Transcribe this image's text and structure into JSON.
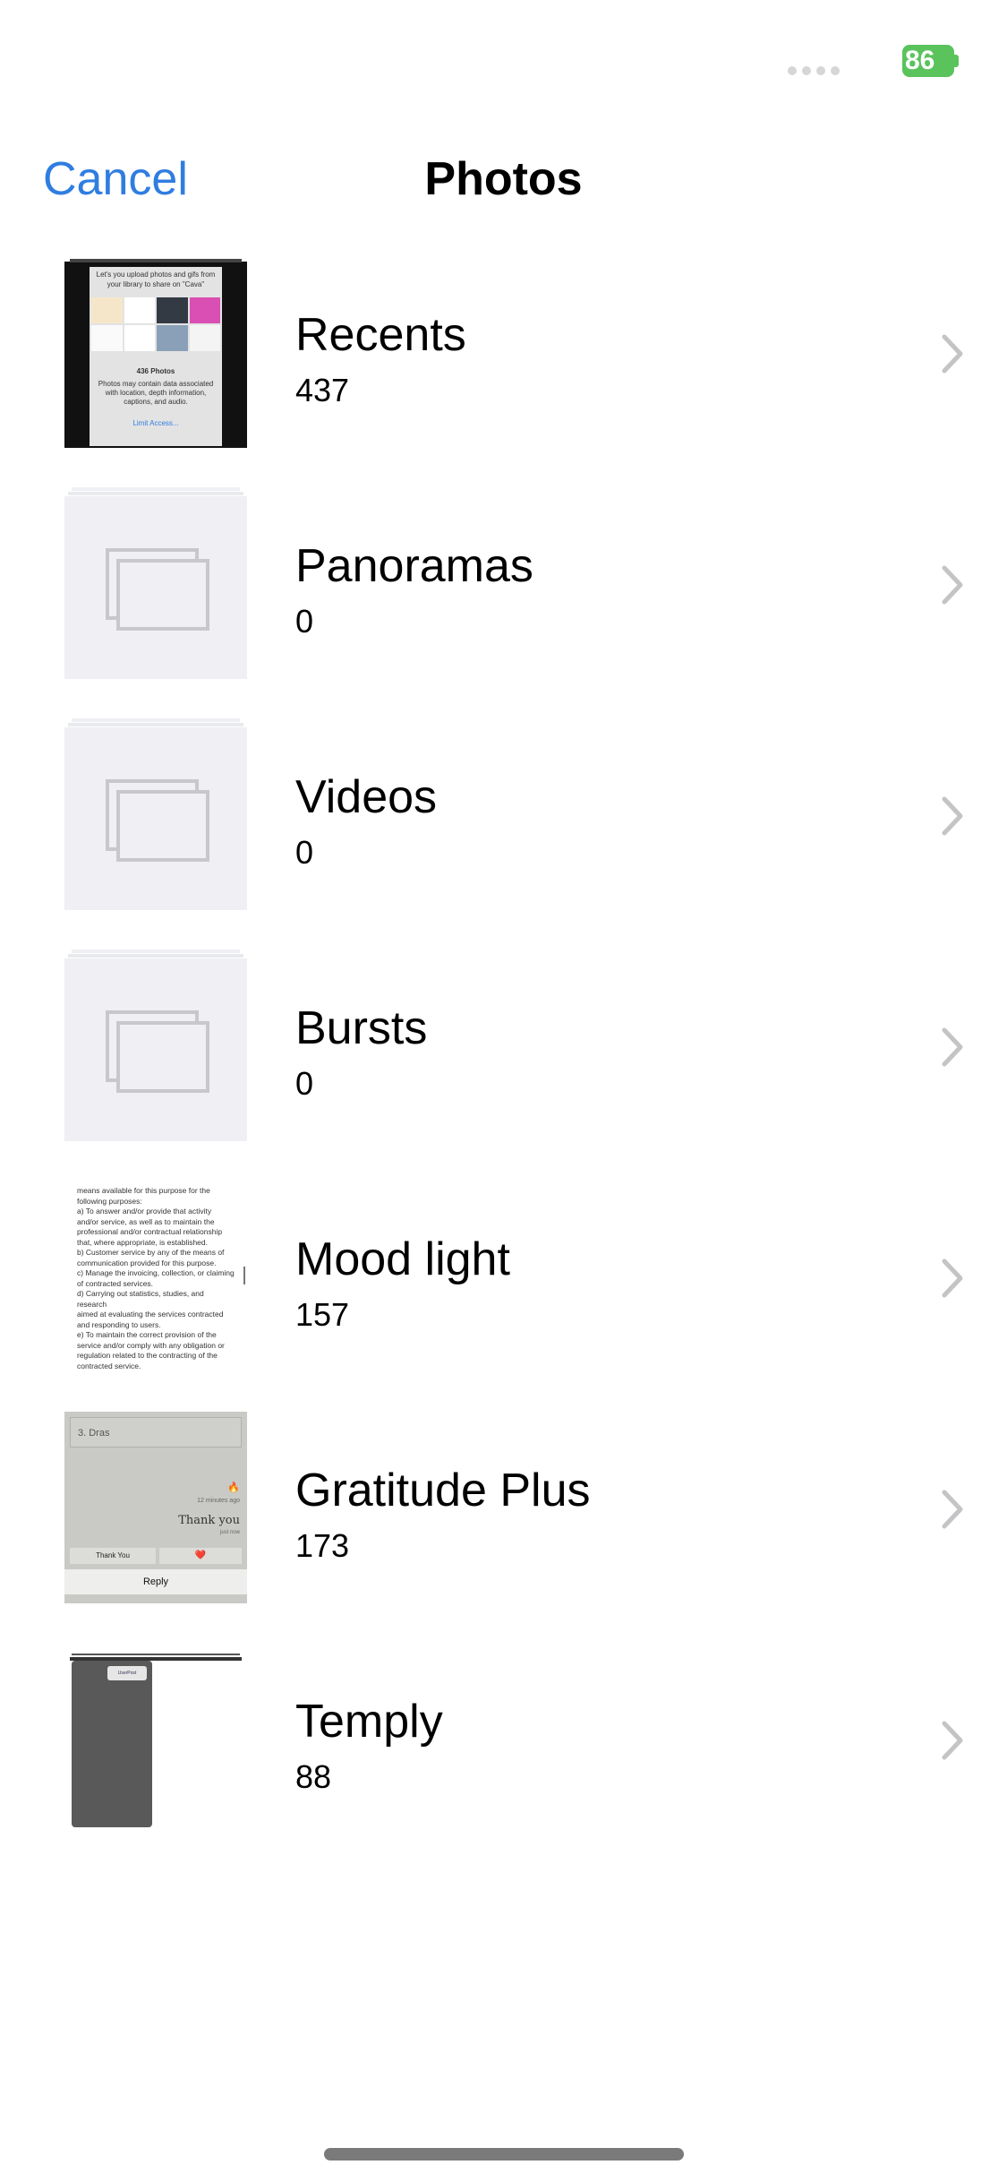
{
  "status_bar": {
    "battery": "86"
  },
  "nav": {
    "cancel_label": "Cancel",
    "title": "Photos"
  },
  "albums": [
    {
      "name": "Recents",
      "count": "437"
    },
    {
      "name": "Panoramas",
      "count": "0"
    },
    {
      "name": "Videos",
      "count": "0"
    },
    {
      "name": "Bursts",
      "count": "0"
    },
    {
      "name": "Mood light",
      "count": "157"
    },
    {
      "name": "Gratitude Plus",
      "count": "173"
    },
    {
      "name": "Temply",
      "count": "88"
    }
  ],
  "recents_thumb": {
    "line1": "Let's you upload photos and gifs from",
    "line2": "your library to share on \"Cava\"",
    "photos": "436 Photos",
    "note": "Photos may contain data associated with location, depth information, captions, and audio.",
    "limit": "Limit Access..."
  },
  "mood_thumb": {
    "text": "means available for this purpose for the\nfollowing purposes:\na) To answer and/or provide that activity\nand/or service, as well as to maintain the\nprofessional and/or contractual relationship\nthat, where appropriate, is established.\nb) Customer service by any of the means of\ncommunication provided for this purpose.\nc) Manage the invoicing, collection, or claiming\nof contracted services.\nd) Carrying out statistics, studies, and research\naimed at evaluating the services contracted\nand responding to users.\ne) To maintain the correct provision of the\nservice and/or comply with any obligation or\nregulation related to the contracting of the\ncontracted service."
  },
  "gratitude_thumb": {
    "field": "3. Dras",
    "time": "12 minutes ago",
    "thank_you": "Thank you",
    "just_now": "just now",
    "button1": "Thank You",
    "button2": "❤️",
    "reply": "Reply"
  },
  "temply_thumb": {
    "chip": "UserPost"
  },
  "colors": {
    "accent": "#2f7de1",
    "battery": "#5ac35c",
    "chevron": "#c4c4c7"
  }
}
